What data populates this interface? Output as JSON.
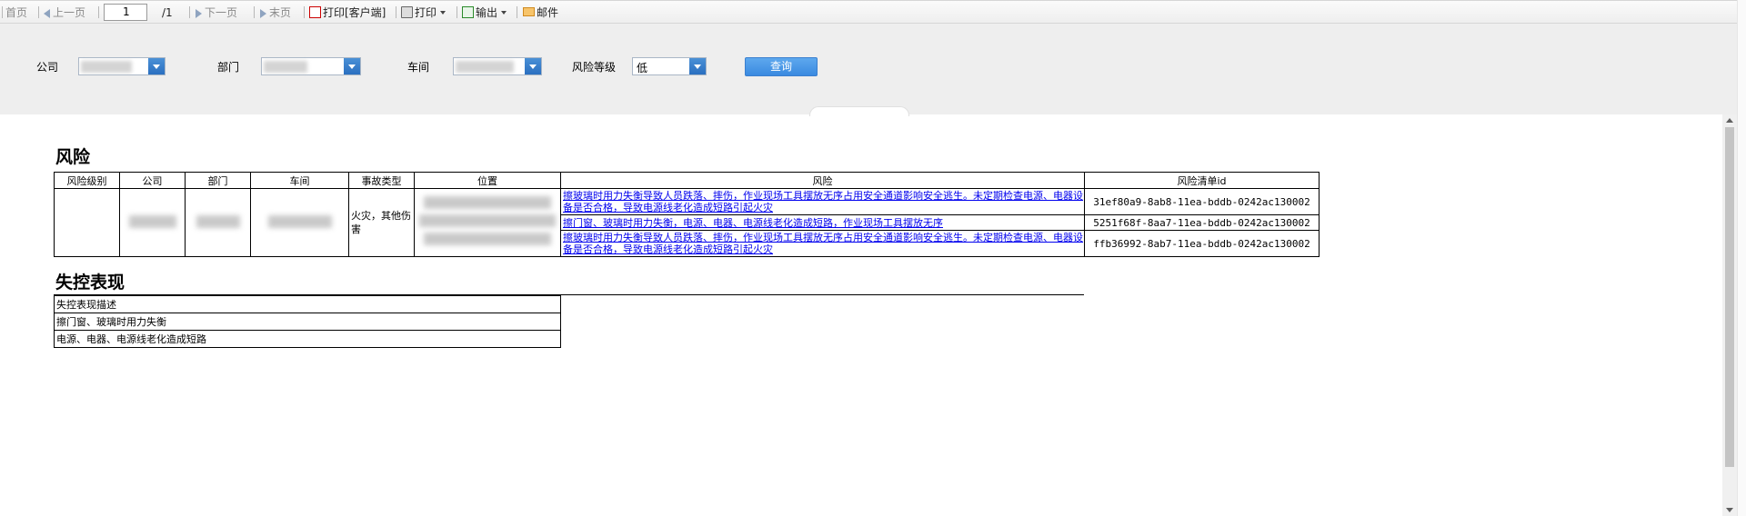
{
  "toolbar": {
    "first": "首页",
    "prev": "上一页",
    "page_value": "1",
    "page_total": "/1",
    "next": "下一页",
    "last": "末页",
    "print_client": "打印[客户端]",
    "print": "打印",
    "export": "输出",
    "mail": "邮件"
  },
  "filters": {
    "company_label": "公司",
    "dept_label": "部门",
    "workshop_label": "车间",
    "risk_level_label": "风险等级",
    "risk_level_value": "低",
    "query_button": "查询"
  },
  "report": {
    "title": "风险",
    "headers": [
      "风险级别",
      "公司",
      "部门",
      "车间",
      "事故类型",
      "位置",
      "风险",
      "风险清单id"
    ],
    "accident_type": "火灾，其他伤害",
    "rows": [
      {
        "risk": "擦玻璃时用力失衡导致人员跌落、摔伤，作业现场工具摆放无序占用安全通道影响安全逃生。未定期检查电源、电器设备是否合格，导致电源线老化造成短路引起火灾",
        "id": "31ef80a9-8ab8-11ea-bddb-0242ac130002"
      },
      {
        "risk": "擦门窗、玻璃时用力失衡，电源、电器、电源线老化造成短路，作业现场工具摆放无序",
        "id": "5251f68f-8aa7-11ea-bddb-0242ac130002"
      },
      {
        "risk": "擦玻璃时用力失衡导致人员跌落、摔伤，作业现场工具摆放无序占用安全通道影响安全逃生。未定期检查电源、电器设备是否合格，导致电源线老化造成短路引起火灾",
        "id": "ffb36992-8ab7-11ea-bddb-0242ac130002"
      }
    ],
    "control_title": "失控表现",
    "control_header": "失控表现描述",
    "control_rows": [
      "擦门窗、玻璃时用力失衡",
      "电源、电器、电源线老化造成短路"
    ]
  },
  "colors": {
    "accent": "#3a8ae0",
    "link": "#0000ee",
    "panel": "#eeeeee"
  }
}
